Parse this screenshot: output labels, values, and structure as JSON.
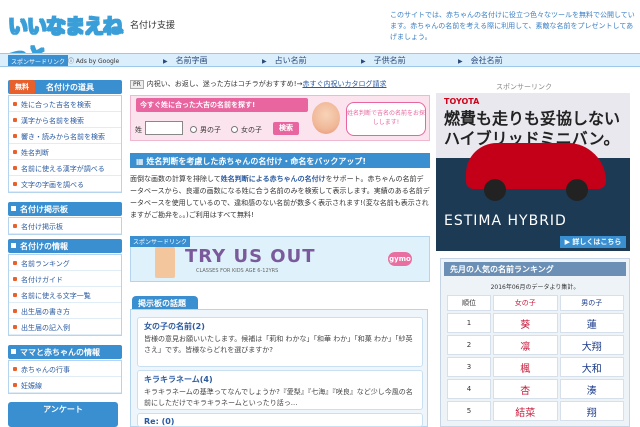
{
  "header": {
    "logo": "いいなまえねっと",
    "subtitle": "名付け支援",
    "intro": "このサイトでは、赤ちゃんの名付けに役立つ色々なツールを無料で公開しています。赤ちゃんの名前を考える際に利用して、素敵な名前をプレゼントしてあげましょう。"
  },
  "nav": {
    "sponsor": "スポンサードリンク",
    "ads": "Ads by Google",
    "items": [
      "名前字画",
      "占い名前",
      "子供名前",
      "会社名前"
    ]
  },
  "sidebar": {
    "badge": "無料",
    "sections": [
      {
        "title": "名付けの道具",
        "items": [
          "姓に合った吉名を検索",
          "漢字から名前を検索",
          "響き・読みから名前を検索",
          "姓名判断",
          "名前に使える漢字が調べる",
          "文字の字画を調べる"
        ]
      },
      {
        "title": "名付け掲示板",
        "items": [
          "名付け掲示板"
        ]
      },
      {
        "title": "名付けの情報",
        "items": [
          "名前ランキング",
          "名付けガイド",
          "名前に使える文字一覧",
          "出生届の書き方",
          "出生届の記入例"
        ]
      },
      {
        "title": "ママと赤ちゃんの情報",
        "items": [
          "赤ちゃんの行事",
          "妊娠線"
        ]
      }
    ],
    "enquete": "アンケート"
  },
  "main": {
    "pr_tag": "PR",
    "pr_text": "内祝い、お返し、迷った方はコチラがおすすめ!→",
    "pr_link": "赤すぐ内祝いカタログ請求",
    "search": {
      "title": "今すぐ姓に合った大吉の名前を探す!",
      "surname_label": "姓",
      "boy_label": "男の子",
      "girl_label": "女の子",
      "button": "検索",
      "bubble": "姓名判断で吉名の名前をお探しします!"
    },
    "section_title": "姓名判断を考慮した赤ちゃんの名付け・命名をバックアップ!",
    "body_pre": "面倒な画数の計算を排除して",
    "body_bold": "姓名判断による赤ちゃんの名付け",
    "body_post": "をサポート。赤ちゃんの名前データベースから、良運の画数になる姓に合う名前のみを検索して表示します。実績のある名前データベースを使用しているので、違和感のない名前が数多く表示されます!(変な名前も表示されますがご勘弁を。。)ご利用はすべて無料!",
    "ad": {
      "label": "スポンサードリンク",
      "text": "TRY US OUT",
      "sub": "CLASSES FOR KIDS AGE 6-12YRS",
      "logo": "gymo"
    },
    "bbs": {
      "tab": "掲示板の話題",
      "posts": [
        {
          "title": "女の子の名前(2)",
          "body": "皆様の意見お願いいたします。候補は「莉和 わかな」「和華 わか」「和菓 わか」「紗英 さえ」です。皆様ならどれを選びますか?"
        },
        {
          "title": "キラキラネーム(4)",
          "body": "キラキラネームの基準ってなんでしょうか?『愛梨』『七海』『咲良』など少し今風の名前にしただけでキラキラネームといったり話っ..."
        },
        {
          "title": "Re: (0)",
          "body": ""
        }
      ]
    }
  },
  "right": {
    "sponsor": "スポンサーリンク",
    "ad": {
      "brand": "TOYOTA",
      "headline": "燃費も走りも妥協しない ハイブリッドミニバン。",
      "model": "ESTIMA HYBRID",
      "more": "▶ 詳しくはこちら"
    },
    "ranking": {
      "title": "先月の人気の名前ランキング",
      "date": "2016年06月のデータより集計。",
      "headers": [
        "順位",
        "女の子",
        "男の子"
      ],
      "rows": [
        {
          "rank": "1",
          "girl": "葵",
          "boy": "蓮"
        },
        {
          "rank": "2",
          "girl": "凛",
          "boy": "大翔"
        },
        {
          "rank": "3",
          "girl": "楓",
          "boy": "大和"
        },
        {
          "rank": "4",
          "girl": "杏",
          "boy": "湊"
        },
        {
          "rank": "5",
          "girl": "結菜",
          "boy": "翔"
        }
      ]
    }
  }
}
